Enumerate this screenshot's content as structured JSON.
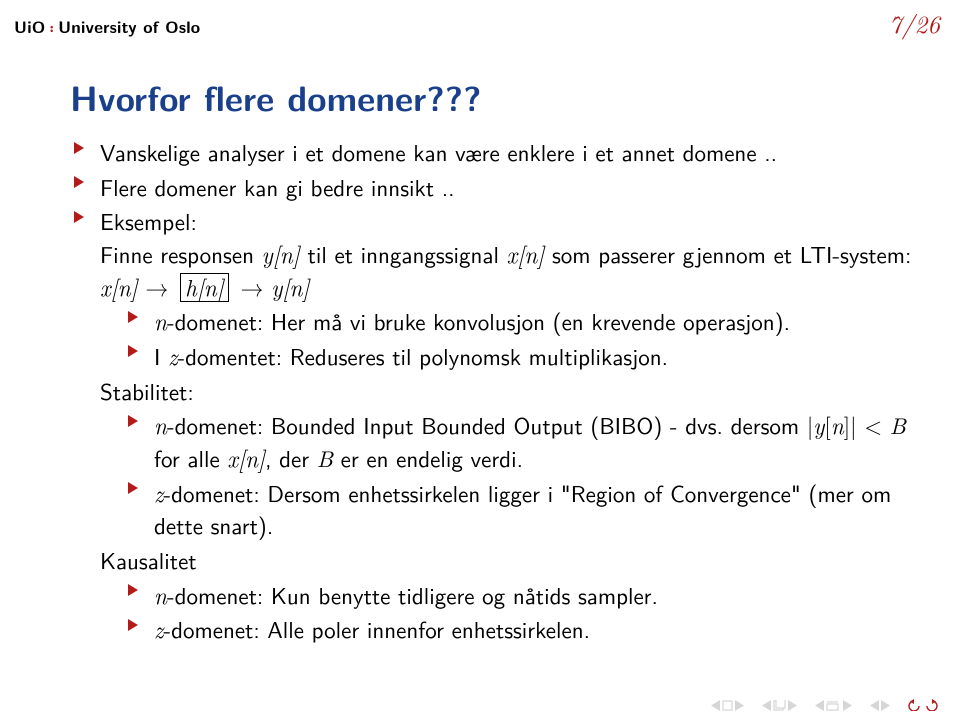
{
  "header": {
    "uio": "UiO",
    "sep": "᛬",
    "uni": "University of Oslo",
    "page": "7/26"
  },
  "title": "Hvorfor flere domener???",
  "items": {
    "b1": "Vanskelige analyser i et domene kan være enklere i et annet domene ..",
    "b2": "Flere domener kan gi bedre innsikt ..",
    "b3a": "Eksempel:",
    "b3b_pre": "Finne responsen ",
    "b3b_yn": "y[n]",
    "b3b_mid1": " til et inngangssignal ",
    "b3b_xn": "x[n]",
    "b3b_mid2": " som passerer gjennom et LTI-system: ",
    "b3b_xn2": "x[n]",
    "b3b_arrow1": " → ",
    "b3b_hn": "h[n]",
    "b3b_arrow2": " → ",
    "b3b_yn2": "y[n]",
    "b3_i1_pre": "n",
    "b3_i1_rest": "-domenet: Her må vi bruke konvolusjon (en krevende operasjon).",
    "b3_i2_pre": "I ",
    "b3_i2_z": "z",
    "b3_i2_rest": "-domentet: Reduseres til polynomsk multiplikasjon.",
    "stab_label": "Stabilitet:",
    "stab_i1_pre": "n",
    "stab_i1_rest": "-domenet: Bounded Input Bounded Output (BIBO) - dvs. dersom ",
    "stab_i1_abs": "|y[n]| < B",
    "stab_i1_mid": " for alle ",
    "stab_i1_xn": "x[n]",
    "stab_i1_tail": ", der ",
    "stab_i1_B": "B",
    "stab_i1_end": " er en endelig verdi.",
    "stab_i2_pre": "z",
    "stab_i2_rest": "-domenet: Dersom enhetssirkelen ligger i \"Region of Convergence\" (mer om dette snart).",
    "kaus_label": "Kausalitet",
    "kaus_i1_pre": "n",
    "kaus_i1_rest": "-domenet: Kun benytte tidligere og nåtids sampler.",
    "kaus_i2_pre": "z",
    "kaus_i2_rest": "-domenet: Alle poler innenfor enhetssirkelen."
  }
}
